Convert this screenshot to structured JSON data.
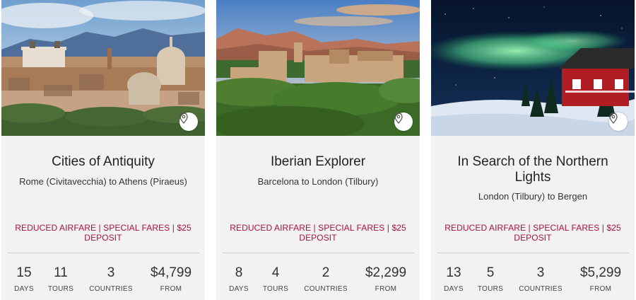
{
  "cards": [
    {
      "title": "Cities of Antiquity",
      "route": "Rome (Civitavecchia) to Athens (Piraeus)",
      "promo": "REDUCED AIRFARE | SPECIAL FARES | $25 DEPOSIT",
      "image": "rome-skyline-photo",
      "stats": {
        "days": "15",
        "days_label": "DAYS",
        "tours": "11",
        "tours_label": "TOURS",
        "countries": "3",
        "countries_label": "COUNTRIES",
        "price": "$4,799",
        "price_label": "FROM"
      }
    },
    {
      "title": "Iberian Explorer",
      "route": "Barcelona to London (Tilbury)",
      "promo": "REDUCED AIRFARE | SPECIAL FARES | $25 DEPOSIT",
      "image": "alhambra-photo",
      "stats": {
        "days": "8",
        "days_label": "DAYS",
        "tours": "4",
        "tours_label": "TOURS",
        "countries": "2",
        "countries_label": "COUNTRIES",
        "price": "$2,299",
        "price_label": "FROM"
      }
    },
    {
      "title": "In Search of the Northern Lights",
      "route": "London (Tilbury) to Bergen",
      "promo": "REDUCED AIRFARE | SPECIAL FARES | $25 DEPOSIT",
      "image": "northern-lights-photo",
      "stats": {
        "days": "13",
        "days_label": "DAYS",
        "tours": "5",
        "tours_label": "TOURS",
        "countries": "3",
        "countries_label": "COUNTRIES",
        "price": "$5,299",
        "price_label": "FROM"
      }
    }
  ],
  "icons": {
    "map_pin": "map-pin-icon"
  },
  "colors": {
    "promo": "#a8123a",
    "card_bg": "#f2f2f2",
    "divider": "#cfcfcf"
  }
}
